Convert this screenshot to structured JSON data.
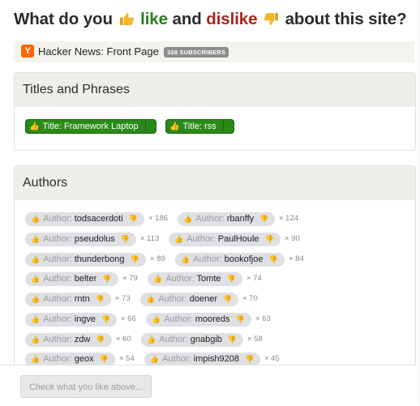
{
  "heading": {
    "before": "What do you",
    "like_word": "like",
    "and_word": "and",
    "dislike_word": "dislike",
    "after": "about this site?"
  },
  "feed": {
    "logo_letter": "Y",
    "name": "Hacker News: Front Page",
    "subscribers": "328 SUBSCRIBERS"
  },
  "titles_panel": {
    "heading": "Titles and Phrases",
    "chips": [
      {
        "label": "Title: Framework Laptop"
      },
      {
        "label": "Title: rss"
      }
    ]
  },
  "authors_panel": {
    "heading": "Authors",
    "prefix": "Author:",
    "rows": [
      [
        {
          "name": "todsacerdoti",
          "count": "× 186"
        },
        {
          "name": "rbanffy",
          "count": "× 124"
        }
      ],
      [
        {
          "name": "pseudolus",
          "count": "× 113"
        },
        {
          "name": "PaulHoule",
          "count": "× 90"
        }
      ],
      [
        {
          "name": "thunderbong",
          "count": "× 89"
        },
        {
          "name": "bookofjoe",
          "count": "× 84"
        }
      ],
      [
        {
          "name": "belter",
          "count": "× 79"
        },
        {
          "name": "Tomte",
          "count": "× 74"
        }
      ],
      [
        {
          "name": "rntn",
          "count": "× 73"
        },
        {
          "name": "doener",
          "count": "× 70"
        }
      ],
      [
        {
          "name": "ingve",
          "count": "× 66"
        },
        {
          "name": "mooreds",
          "count": "× 63"
        }
      ],
      [
        {
          "name": "zdw",
          "count": "× 60"
        },
        {
          "name": "gnabgib",
          "count": "× 58"
        }
      ],
      [
        {
          "name": "geox",
          "count": "× 54"
        },
        {
          "name": "impish9208",
          "count": "× 45"
        }
      ]
    ]
  },
  "footer": {
    "button_label": "Check what you like above..."
  },
  "colors": {
    "like": "#2f7d20",
    "dislike": "#a8261c",
    "chip_green": "#2a8a18",
    "author_chip": "#dfe0e3",
    "feed_logo": "#ff6600"
  },
  "icons": [
    "thumbs-up-icon",
    "thumbs-down-icon",
    "hacker-news-logo"
  ]
}
